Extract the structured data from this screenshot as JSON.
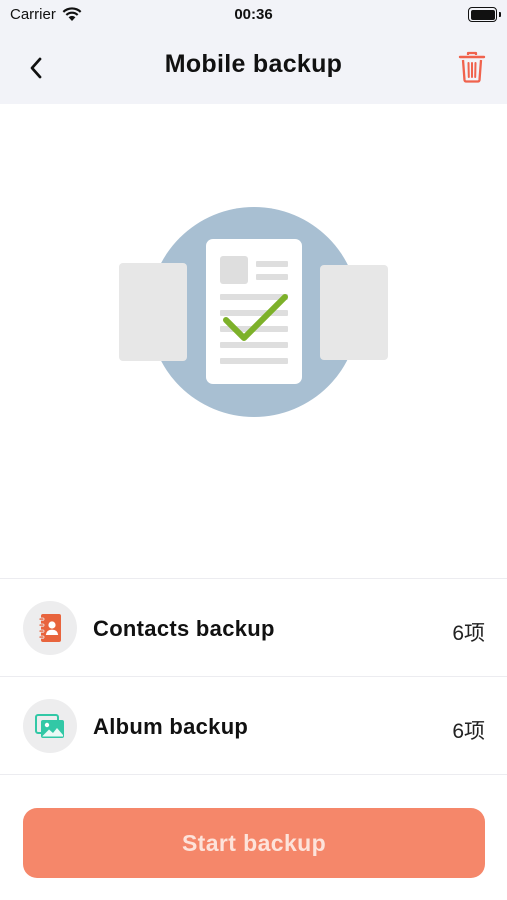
{
  "status_bar": {
    "carrier": "Carrier",
    "time": "00:36"
  },
  "nav": {
    "title": "Mobile backup",
    "back_icon": "chevron-left-icon",
    "delete_icon": "trash-icon",
    "delete_color": "#f0624d"
  },
  "hero": {
    "illustration": "document-checkmark-illustration",
    "circle_color": "#a8bfd2",
    "check_color": "#7db12a"
  },
  "backup_items": [
    {
      "label": "Contacts backup",
      "count": "6项",
      "icon": "contacts-book-icon",
      "icon_color": "#e8643d"
    },
    {
      "label": "Album backup",
      "count": "6项",
      "icon": "photo-album-icon",
      "icon_color": "#32c8a6"
    }
  ],
  "actions": {
    "start_label": "Start backup",
    "accent": "#f5876a"
  }
}
